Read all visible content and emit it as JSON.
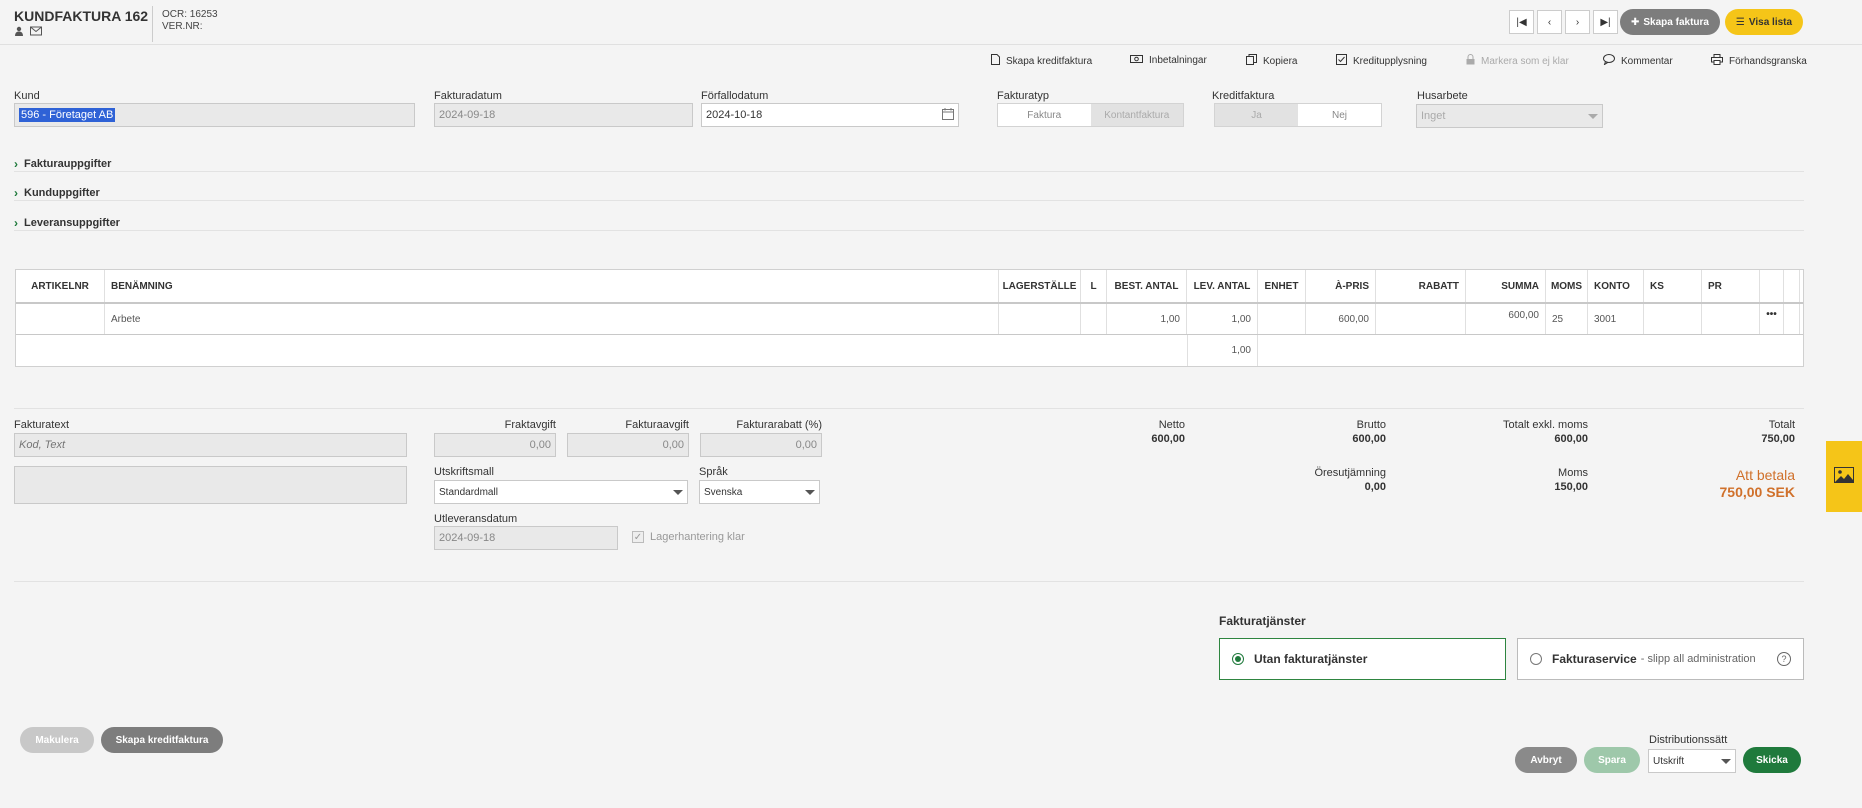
{
  "header": {
    "title": "KUNDFAKTURA 162",
    "ocr": "OCR: 16253",
    "ver": "VER.NR:",
    "btn_new": "Skapa faktura",
    "btn_list": "Visa lista"
  },
  "actions": [
    {
      "label": "Skapa kreditfaktura",
      "icon": "document-icon"
    },
    {
      "label": "Inbetalningar",
      "icon": "money-icon"
    },
    {
      "label": "Kopiera",
      "icon": "copy-icon"
    },
    {
      "label": "Kreditupplysning",
      "icon": "check-icon"
    },
    {
      "label": "Markera som ej klar",
      "icon": "lock-icon"
    },
    {
      "label": "Kommentar",
      "icon": "comment-icon"
    },
    {
      "label": "Förhandsgranska",
      "icon": "print-icon"
    }
  ],
  "form": {
    "kund_label": "Kund",
    "kund_value": "596 - Företaget AB",
    "fakturadatum_label": "Fakturadatum",
    "fakturadatum_value": "2024-09-18",
    "forfallodatum_label": "Förfallodatum",
    "forfallodatum_value": "2024-10-18",
    "fakturatyp_label": "Fakturatyp",
    "fakturatyp_options": [
      "Faktura",
      "Kontantfaktura"
    ],
    "kreditfaktura_label": "Kreditfaktura",
    "kreditfaktura_options": [
      "Ja",
      "Nej"
    ],
    "husarbete_label": "Husarbete",
    "husarbete_value": "Inget"
  },
  "sections": [
    "Fakturauppgifter",
    "Kunduppgifter",
    "Leveransuppgifter"
  ],
  "table": {
    "headers": [
      "ARTIKELNR",
      "BENÄMNING",
      "LAGERSTÄLLE",
      "L",
      "BEST. ANTAL",
      "LEV. ANTAL",
      "ENHET",
      "À-PRIS",
      "RABATT",
      "SUMMA",
      "MOMS",
      "KONTO",
      "KS",
      "PR"
    ],
    "row": {
      "artikelnr": "",
      "benamning": "Arbete",
      "best_antal": "1,00",
      "lev_antal": "1,00",
      "a_pris": "600,00",
      "summa": "600,00",
      "moms": "25",
      "konto": "3001",
      "menu": "•••"
    },
    "total_lev_antal": "1,00"
  },
  "bottom": {
    "fakturatext_label": "Fakturatext",
    "fakturatext_placeholder": "Kod, Text",
    "fraktavgift_label": "Fraktavgift",
    "fraktavgift_value": "0,00",
    "fakturaavgift_label": "Fakturaavgift",
    "fakturaavgift_value": "0,00",
    "fakturarabatt_label": "Fakturarabatt (%)",
    "fakturarabatt_value": "0,00",
    "utskriftsmall_label": "Utskriftsmall",
    "utskriftsmall_value": "Standardmall",
    "sprak_label": "Språk",
    "sprak_value": "Svenska",
    "utleveransdatum_label": "Utleveransdatum",
    "utleveransdatum_value": "2024-09-18",
    "lagerhantering_label": "Lagerhantering klar"
  },
  "totals": {
    "netto_label": "Netto",
    "netto": "600,00",
    "brutto_label": "Brutto",
    "brutto": "600,00",
    "exkl_label": "Totalt exkl. moms",
    "exkl": "600,00",
    "totalt_label": "Totalt",
    "totalt": "750,00",
    "ore_label": "Öresutjämning",
    "ore": "0,00",
    "moms_label": "Moms",
    "moms": "150,00",
    "att_betala_label": "Att betala",
    "att_betala": "750,00 SEK"
  },
  "services": {
    "title": "Fakturatjänster",
    "opt1": "Utan fakturatjänster",
    "opt2": "Fakturaservice",
    "opt2_sub": "- slipp all administration"
  },
  "footer": {
    "makulera": "Makulera",
    "kredit": "Skapa kreditfaktura",
    "avbryt": "Avbryt",
    "spara": "Spara",
    "dist_label": "Distributionssätt",
    "dist_value": "Utskrift",
    "skicka": "Skicka"
  },
  "colors": {
    "accent_green": "#1f7a3c",
    "yellow": "#f5c518",
    "orange": "#d0702a"
  }
}
